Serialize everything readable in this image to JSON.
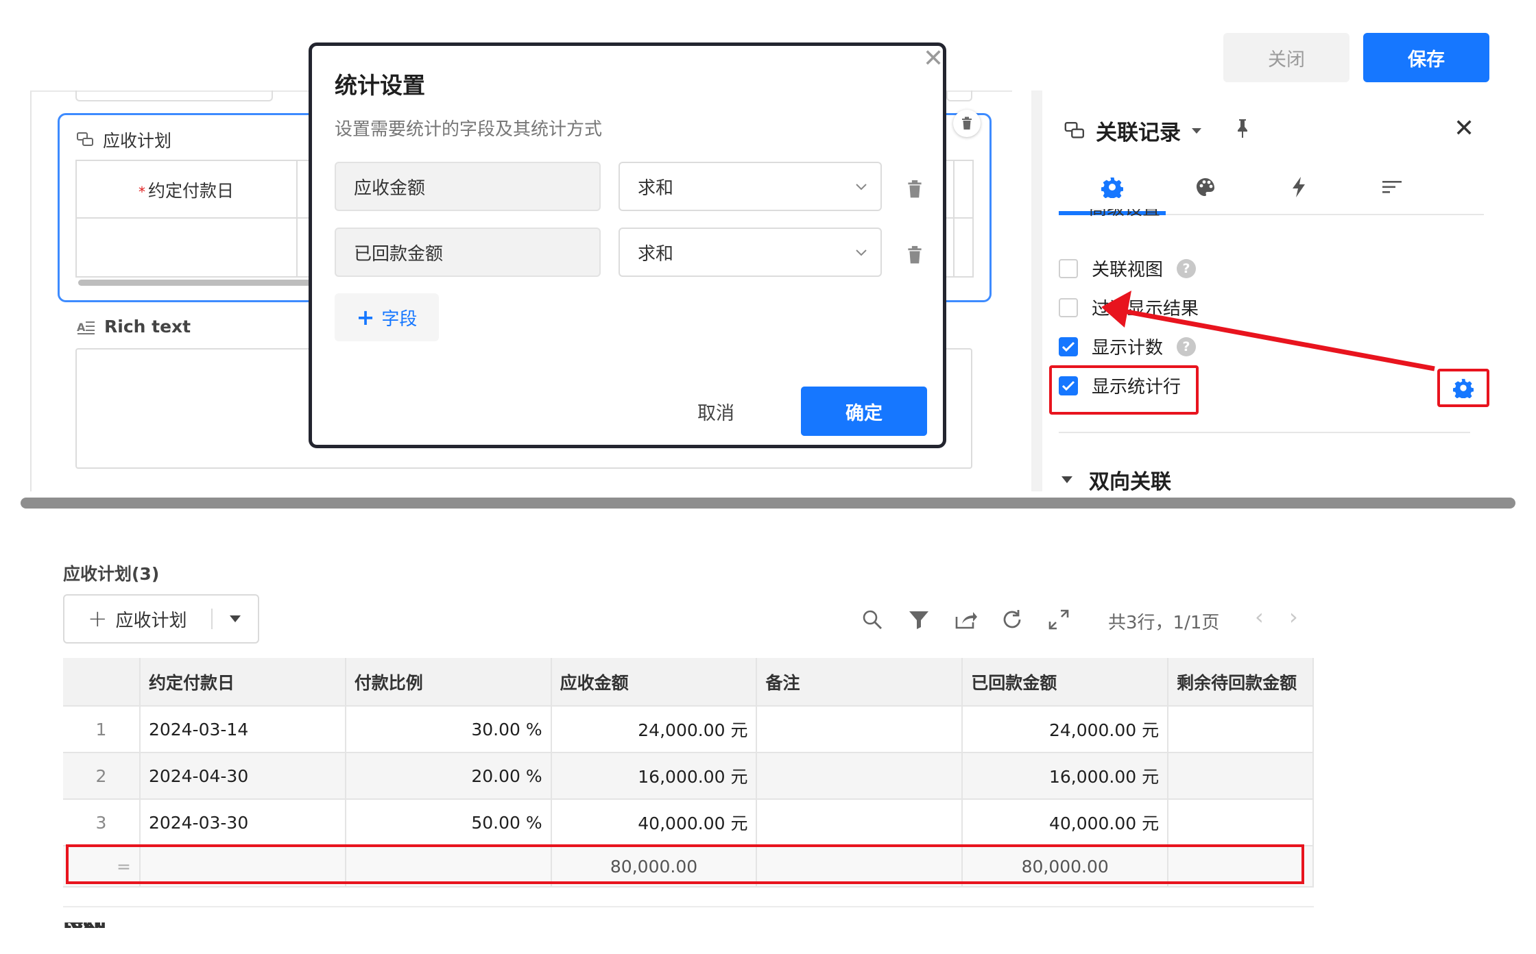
{
  "topbar": {
    "close_label": "关闭",
    "save_label": "保存"
  },
  "editor": {
    "card_title": "应收计划",
    "inner_column": "约定付款日",
    "rich_text_title": "Rich text"
  },
  "settings_panel": {
    "title": "关联记录",
    "tabs": [
      "gear-icon",
      "palette-icon",
      "lightning-icon",
      "sort-icon"
    ],
    "cut_text": "高级设置",
    "options": [
      {
        "label": "关联视图",
        "checked": false,
        "help": true
      },
      {
        "label": "过滤显示结果",
        "checked": false,
        "help": false
      },
      {
        "label": "显示计数",
        "checked": true,
        "help": true
      },
      {
        "label": "显示统计行",
        "checked": true,
        "help": false
      }
    ],
    "section_title": "双向关联",
    "accent_color": "#1677ff",
    "annotation_color": "#e8141e"
  },
  "modal": {
    "title": "统计设置",
    "description": "设置需要统计的字段及其统计方式",
    "rows": [
      {
        "field": "应收金额",
        "method": "求和"
      },
      {
        "field": "已回款金额",
        "method": "求和"
      }
    ],
    "add_label": "字段",
    "cancel_label": "取消",
    "ok_label": "确定"
  },
  "subtable": {
    "title": "应收计划(3)",
    "add_label": "应收计划",
    "pager": "共3行，1/1页",
    "columns": [
      "",
      "约定付款日",
      "付款比例",
      "应收金额",
      "备注",
      "已回款金额",
      "剩余待回款金额"
    ],
    "rows": [
      {
        "idx": "1",
        "date": "2024-03-14",
        "ratio": "30.00 %",
        "amount": "24,000.00 元",
        "note": "",
        "received": "24,000.00 元",
        "remaining": ""
      },
      {
        "idx": "2",
        "date": "2024-04-30",
        "ratio": "20.00 %",
        "amount": "16,000.00 元",
        "note": "",
        "received": "16,000.00 元",
        "remaining": ""
      },
      {
        "idx": "3",
        "date": "2024-03-30",
        "ratio": "50.00 %",
        "amount": "40,000.00 元",
        "note": "",
        "received": "40,000.00 元",
        "remaining": ""
      }
    ],
    "summary": {
      "marker": "=",
      "amount": "80,000.00",
      "received": "80,000.00"
    },
    "trailing_label": "Rich text"
  }
}
